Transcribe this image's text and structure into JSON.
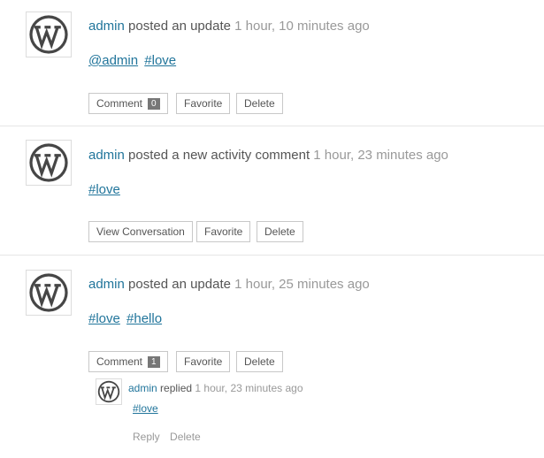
{
  "activities": [
    {
      "user": "admin",
      "action": "posted an update",
      "time": "1 hour, 10 minutes ago",
      "tags": [
        "@admin",
        "#love"
      ],
      "buttons": {
        "comment": "Comment",
        "comment_count": "0",
        "favorite": "Favorite",
        "delete": "Delete"
      }
    },
    {
      "user": "admin",
      "action": "posted a new activity comment",
      "time": "1 hour, 23 minutes ago",
      "tags": [
        "#love"
      ],
      "buttons": {
        "view_conversation": "View Conversation",
        "favorite": "Favorite",
        "delete": "Delete"
      }
    },
    {
      "user": "admin",
      "action": "posted an update",
      "time": "1 hour, 25 minutes ago",
      "tags": [
        "#love",
        "#hello"
      ],
      "buttons": {
        "comment": "Comment",
        "comment_count": "1",
        "favorite": "Favorite",
        "delete": "Delete"
      },
      "reply": {
        "user": "admin",
        "action": "replied",
        "time": "1 hour, 23 minutes ago",
        "tags": [
          "#love"
        ],
        "reply_label": "Reply",
        "delete_label": "Delete"
      }
    }
  ],
  "icons": {
    "avatar": "wordpress-logo-icon"
  },
  "colors": {
    "link": "#21759b",
    "meta": "#999999",
    "count_badge": "#777777"
  }
}
